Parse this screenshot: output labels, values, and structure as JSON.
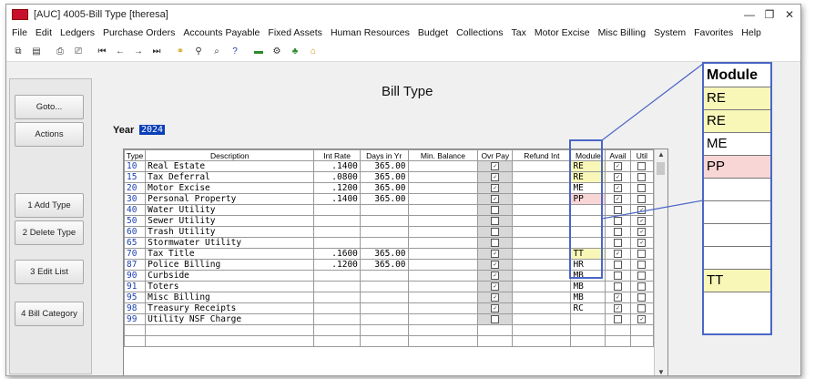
{
  "window": {
    "title": "[AUC] 4005-Bill Type [theresa]",
    "controls": {
      "minimize": "—",
      "maximize": "❐",
      "close": "✕"
    }
  },
  "menu": [
    "File",
    "Edit",
    "Ledgers",
    "Purchase Orders",
    "Accounts Payable",
    "Fixed Assets",
    "Human Resources",
    "Budget",
    "Collections",
    "Tax",
    "Motor Excise",
    "Misc Billing",
    "System",
    "Favorites",
    "Help"
  ],
  "toolbar": {
    "icons": [
      "copy-icon",
      "paste-icon",
      "print-icon",
      "print-preview-icon",
      "first-record-icon",
      "previous-record-icon",
      "next-record-icon",
      "last-record-icon",
      "binoculars-icon",
      "search-all-icon",
      "zoom-icon",
      "help-pointer-icon",
      "export-icon",
      "settings-icon",
      "module-icon",
      "home-icon"
    ]
  },
  "sidebar": {
    "goto": "Goto...",
    "actions": "Actions",
    "add_type": "1 Add Type",
    "delete_type": "2 Delete Type",
    "edit_list": "3 Edit List",
    "bill_category": "4 Bill Category"
  },
  "page": {
    "heading": "Bill Type",
    "year_label": "Year",
    "year_value": "2024"
  },
  "grid": {
    "headers": [
      "Type",
      "Description",
      "Int Rate",
      "Days in Yr",
      "Min. Balance",
      "Ovr Pay",
      "Refund Int",
      "Module",
      "Avail",
      "Util"
    ],
    "rows": [
      {
        "type": "10",
        "description": "Real Estate",
        "int_rate": ".1400",
        "days": "365.00",
        "ovr_pay": true,
        "module": "RE",
        "avail": true,
        "util": false
      },
      {
        "type": "15",
        "description": "Tax Deferral",
        "int_rate": ".0800",
        "days": "365.00",
        "ovr_pay": true,
        "module": "RE",
        "avail": true,
        "util": false
      },
      {
        "type": "20",
        "description": "Motor Excise",
        "int_rate": ".1200",
        "days": "365.00",
        "ovr_pay": true,
        "module": "ME",
        "avail": true,
        "util": false
      },
      {
        "type": "30",
        "description": "Personal Property",
        "int_rate": ".1400",
        "days": "365.00",
        "ovr_pay": true,
        "module": "PP",
        "avail": true,
        "util": false
      },
      {
        "type": "40",
        "description": "Water Utility",
        "int_rate": "",
        "days": "",
        "ovr_pay": false,
        "module": "",
        "avail": false,
        "util": true
      },
      {
        "type": "50",
        "description": "Sewer Utility",
        "int_rate": "",
        "days": "",
        "ovr_pay": false,
        "module": "",
        "avail": false,
        "util": true
      },
      {
        "type": "60",
        "description": "Trash Utility",
        "int_rate": "",
        "days": "",
        "ovr_pay": false,
        "module": "",
        "avail": false,
        "util": true
      },
      {
        "type": "65",
        "description": "Stormwater Utility",
        "int_rate": "",
        "days": "",
        "ovr_pay": false,
        "module": "",
        "avail": false,
        "util": true
      },
      {
        "type": "70",
        "description": "Tax Title",
        "int_rate": ".1600",
        "days": "365.00",
        "ovr_pay": true,
        "module": "TT",
        "avail": true,
        "util": false
      },
      {
        "type": "87",
        "description": "Police Billing",
        "int_rate": ".1200",
        "days": "365.00",
        "ovr_pay": true,
        "module": "HR",
        "avail": false,
        "util": false
      },
      {
        "type": "90",
        "description": "Curbside",
        "int_rate": "",
        "days": "",
        "ovr_pay": true,
        "module": "MB",
        "avail": false,
        "util": false
      },
      {
        "type": "91",
        "description": "Toters",
        "int_rate": "",
        "days": "",
        "ovr_pay": true,
        "module": "MB",
        "avail": false,
        "util": false
      },
      {
        "type": "95",
        "description": "Misc Billing",
        "int_rate": "",
        "days": "",
        "ovr_pay": true,
        "module": "MB",
        "avail": true,
        "util": false
      },
      {
        "type": "98",
        "description": "Treasury Receipts",
        "int_rate": "",
        "days": "",
        "ovr_pay": true,
        "module": "RC",
        "avail": true,
        "util": false
      },
      {
        "type": "99",
        "description": "Utility NSF Charge",
        "int_rate": "",
        "days": "",
        "ovr_pay": false,
        "module": "",
        "avail": false,
        "util": true
      }
    ]
  },
  "callout": {
    "header": "Module",
    "values": [
      "RE",
      "RE",
      "ME",
      "PP",
      "",
      "",
      "",
      "",
      "TT"
    ]
  },
  "colors": {
    "highlight": "#4b66c7",
    "module_yellow": "#f8f7b8",
    "module_pink": "#f8d6d6",
    "year_bg": "#0a3fb8"
  }
}
